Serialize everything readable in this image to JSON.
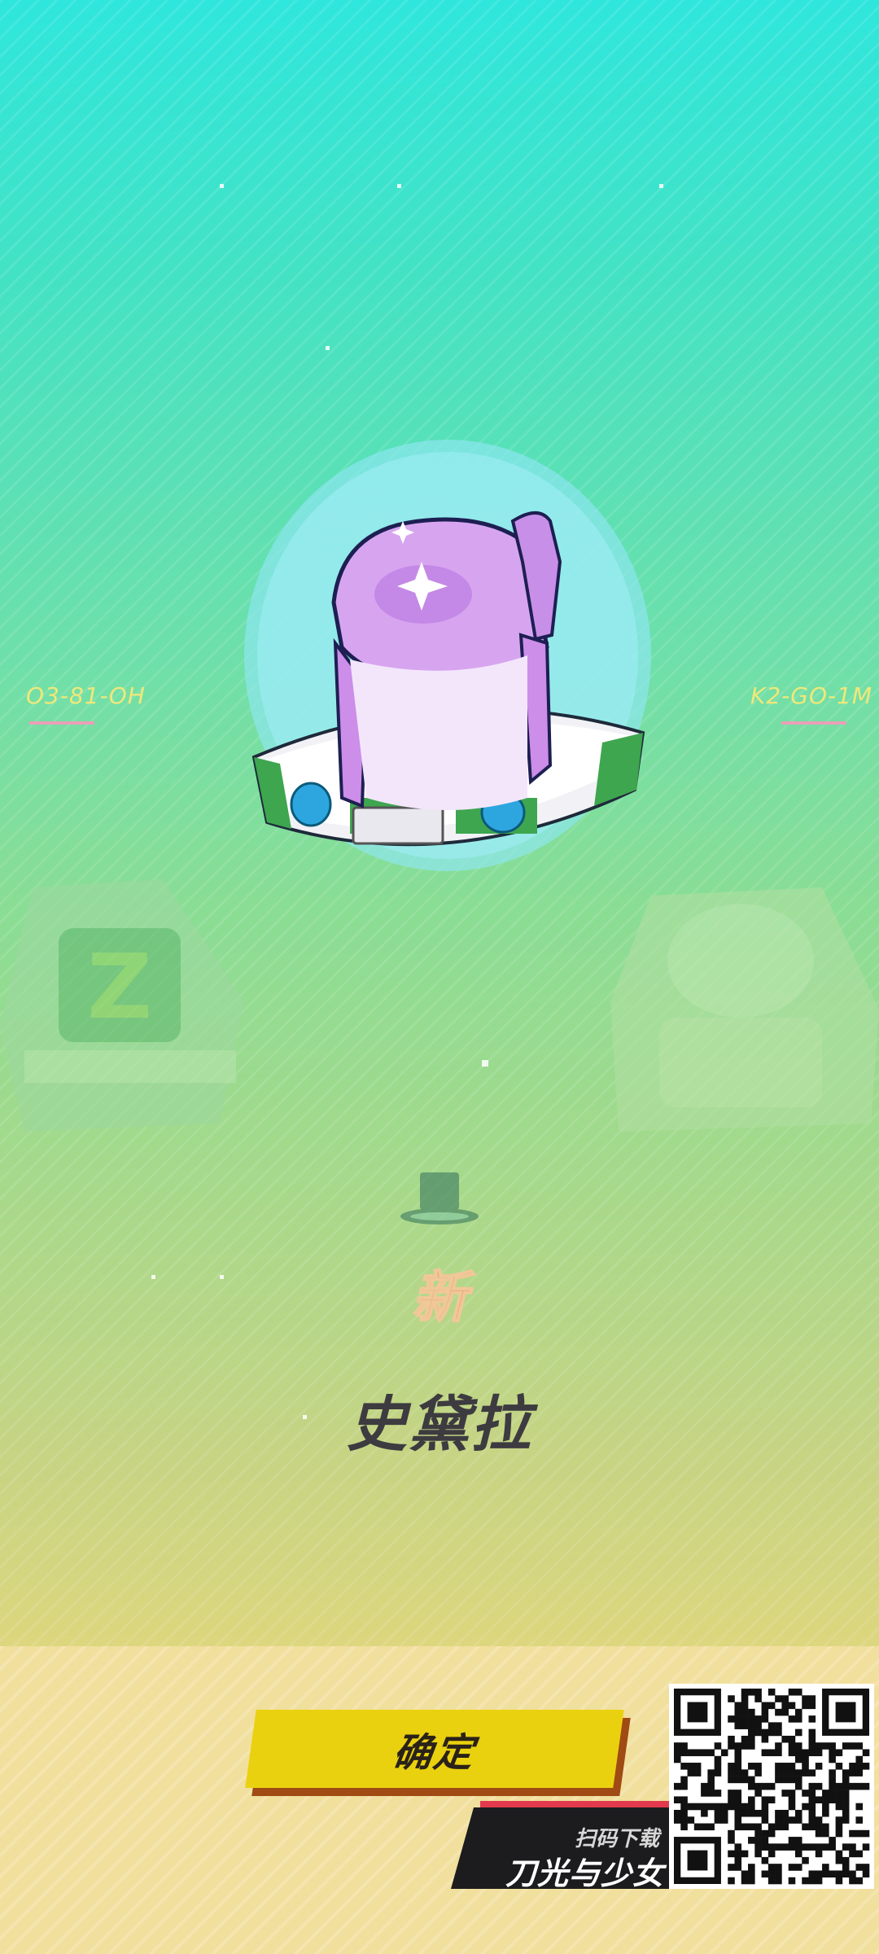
{
  "screen": {
    "left_code": "O3-81-OH",
    "right_code": "K2-GO-1M"
  },
  "reward": {
    "new_badge": "新",
    "item_name": "史黛拉"
  },
  "actions": {
    "confirm_label": "确定"
  },
  "promo": {
    "scan_label": "扫码下载",
    "game_title": "刀光与少女"
  },
  "icons": {
    "hair_item": "purple-hair-bun-icon",
    "hat": "top-hat-icon",
    "qr": "qr-code-icon"
  },
  "colors": {
    "confirm_button": "#ead10f",
    "confirm_shadow": "#a04a14",
    "new_badge": "#ea9f63",
    "item_name": "#3d3b40",
    "promo_bar": "#1c1c1e",
    "promo_accent": "#e23a4c"
  }
}
